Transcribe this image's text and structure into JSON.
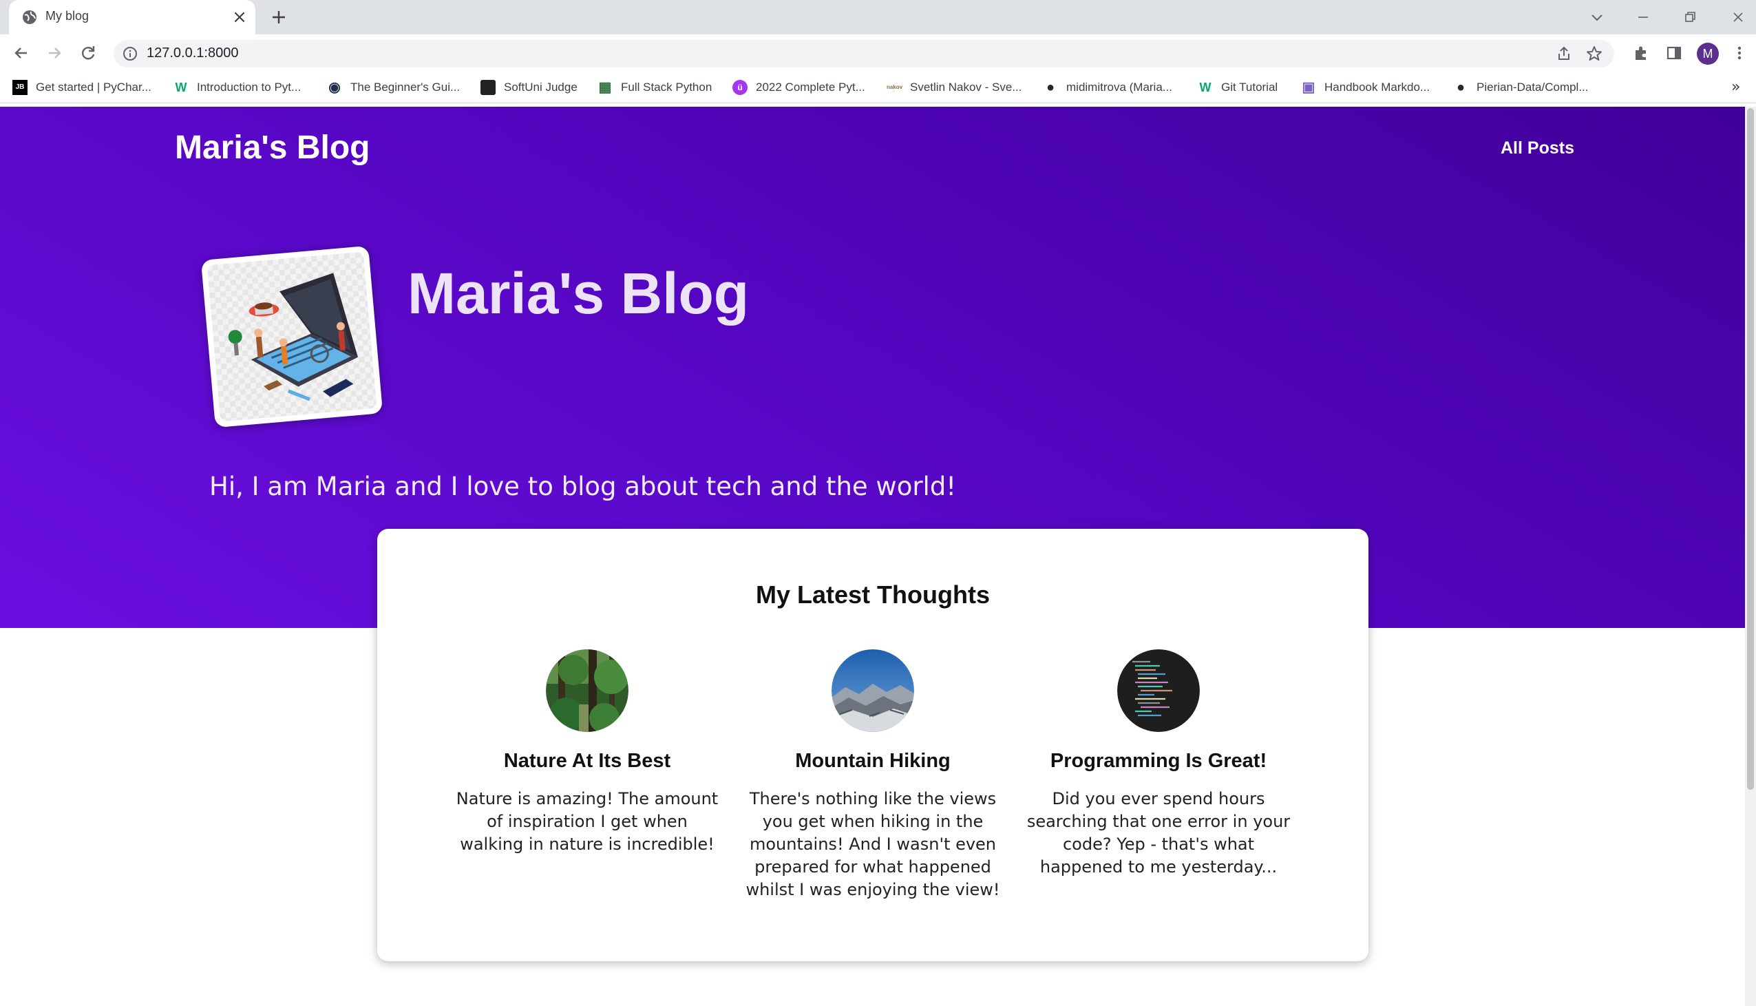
{
  "browser": {
    "tab_title": "My blog",
    "tab_close_glyph": "×",
    "url": "127.0.0.1:8000",
    "profile_initial": "M",
    "more_bookmarks_glyph": "»",
    "bookmarks": [
      {
        "label": "Get started | PyChar...",
        "icon": "jetbrains-icon",
        "icon_text": "JB",
        "color": "#000000"
      },
      {
        "label": "Introduction to Pyt...",
        "icon": "w3-icon",
        "icon_text": "W",
        "color": "#04aa6d"
      },
      {
        "label": "The Beginner's Gui...",
        "icon": "python-guide-icon",
        "icon_text": "◉",
        "color": "#1c2f4a"
      },
      {
        "label": "SoftUni Judge",
        "icon": "softuni-icon",
        "icon_text": "",
        "color": "#222222"
      },
      {
        "label": "Full Stack Python",
        "icon": "fullstack-icon",
        "icon_text": "▦",
        "color": "#2f6f3a"
      },
      {
        "label": "2022 Complete Pyt...",
        "icon": "udemy-icon",
        "icon_text": "ü",
        "color": "#a435f0"
      },
      {
        "label": "Svetlin Nakov - Sve...",
        "icon": "nakov-icon",
        "icon_text": "nakov",
        "color": "#8a6d3b"
      },
      {
        "label": "midimitrova (Maria...",
        "icon": "github-icon",
        "icon_text": "●",
        "color": "#24292e"
      },
      {
        "label": "Git Tutorial",
        "icon": "w3-icon",
        "icon_text": "W",
        "color": "#04aa6d"
      },
      {
        "label": "Handbook Markdo...",
        "icon": "markdown-icon",
        "icon_text": "▣",
        "color": "#7b61c4"
      },
      {
        "label": "Pierian-Data/Compl...",
        "icon": "github-icon",
        "icon_text": "●",
        "color": "#24292e"
      }
    ]
  },
  "site": {
    "logo": "Maria's Blog",
    "nav": {
      "all_posts": "All Posts"
    }
  },
  "hero": {
    "title": "Maria's Blog",
    "tagline": "Hi, I am Maria and I love to blog about tech and the world!"
  },
  "latest": {
    "heading": "My Latest Thoughts",
    "posts": [
      {
        "title": "Nature At Its Best",
        "excerpt": "Nature is amazing! The amount of inspiration I get when walking in nature is incredible!",
        "image": "forest-image"
      },
      {
        "title": "Mountain Hiking",
        "excerpt": "There's nothing like the views you get when hiking in the mountains! And I wasn't even prepared for what happened whilst I was enjoying the view!",
        "image": "mountain-image"
      },
      {
        "title": "Programming Is Great!",
        "excerpt": "Did you ever spend hours searching that one error in your code? Yep - that's what happened to me yesterday...",
        "image": "code-image"
      }
    ]
  },
  "colors": {
    "hero_top": "#420099",
    "hero_bottom": "#6a0fe0",
    "avatar": "#5b2e91"
  }
}
